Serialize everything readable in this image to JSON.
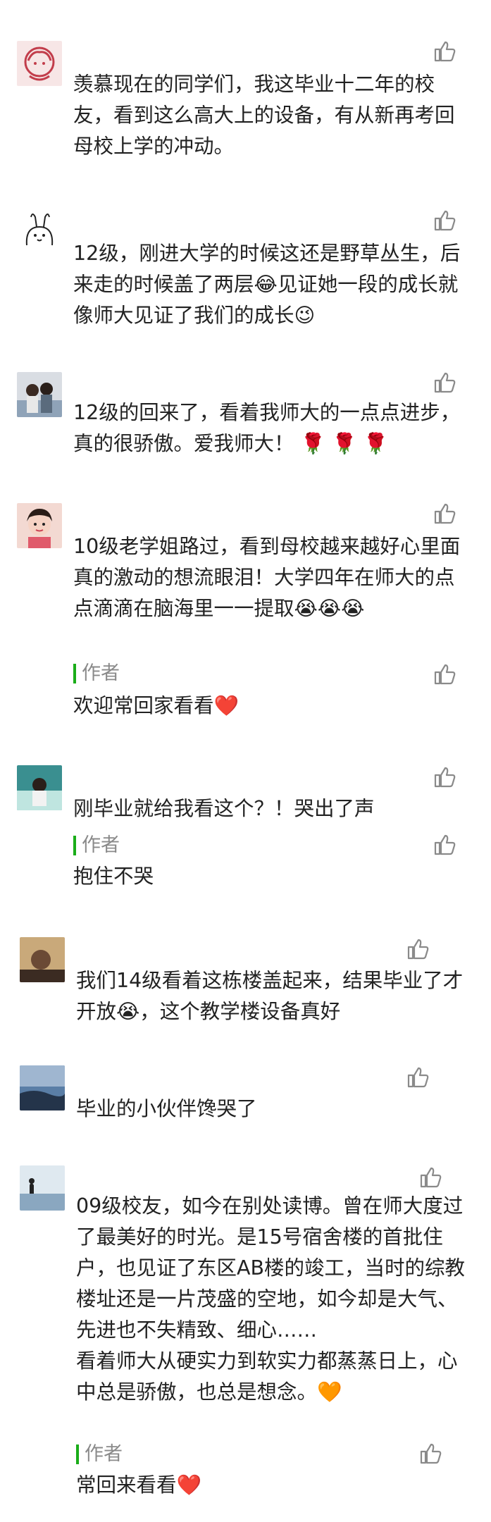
{
  "comments": [
    {
      "avatar": "pink-hair-avatar",
      "text": "羡慕现在的同学们，我这毕业十二年的校友，看到这么高大上的设备，有从新再考回母校上学的冲动。"
    },
    {
      "avatar": "cartoon-rabbit-avatar",
      "text": "12级，刚进大学的时候这还是野草丛生，后来走的时候盖了两层😂见证她一段的成长就像师大见证了我们的成长😉"
    },
    {
      "avatar": "couple-photo-avatar",
      "text": "12级的回来了，看着我师大的一点点进步，真的很骄傲。爱我师大！ 🌹 🌹 🌹"
    },
    {
      "avatar": "girl-selfie-avatar",
      "text": "10级老学姐路过，看到母校越来越好心里面真的激动的想流眼泪！大学四年在师大的点点滴滴在脑海里一一提取😭😭😭",
      "reply": {
        "label": "作者",
        "text": "欢迎常回家看看❤️"
      }
    },
    {
      "avatar": "girl-cyan-avatar",
      "text": "刚毕业就给我看这个？！哭出了声",
      "reply": {
        "label": "作者",
        "text": "抱住不哭"
      }
    },
    {
      "avatar": "dark-portrait-avatar",
      "text": "我们14级看着这栋楼盖起来，结果毕业了才开放😭，这个教学楼设备真好"
    },
    {
      "avatar": "sky-landscape-avatar",
      "text": "毕业的小伙伴馋哭了"
    },
    {
      "avatar": "beach-silhouette-avatar",
      "text": "09级校友，如今在别处读博。曾在师大度过了最美好的时光。是15号宿舍楼的首批住户，也见证了东区AB楼的竣工，当时的综教楼址还是一片茂盛的空地，如今却是大气、先进也不失精致、细心……\n看着师大从硬实力到软实力都蒸蒸日上，心中总是骄傲，也总是想念。🧡",
      "reply": {
        "label": "作者",
        "text": "常回来看看❤️"
      }
    }
  ],
  "colors": {
    "text": "#222222",
    "author_label": "#8a8a8a",
    "author_bar": "#1aad19",
    "like_icon": "#8a8a8a"
  }
}
